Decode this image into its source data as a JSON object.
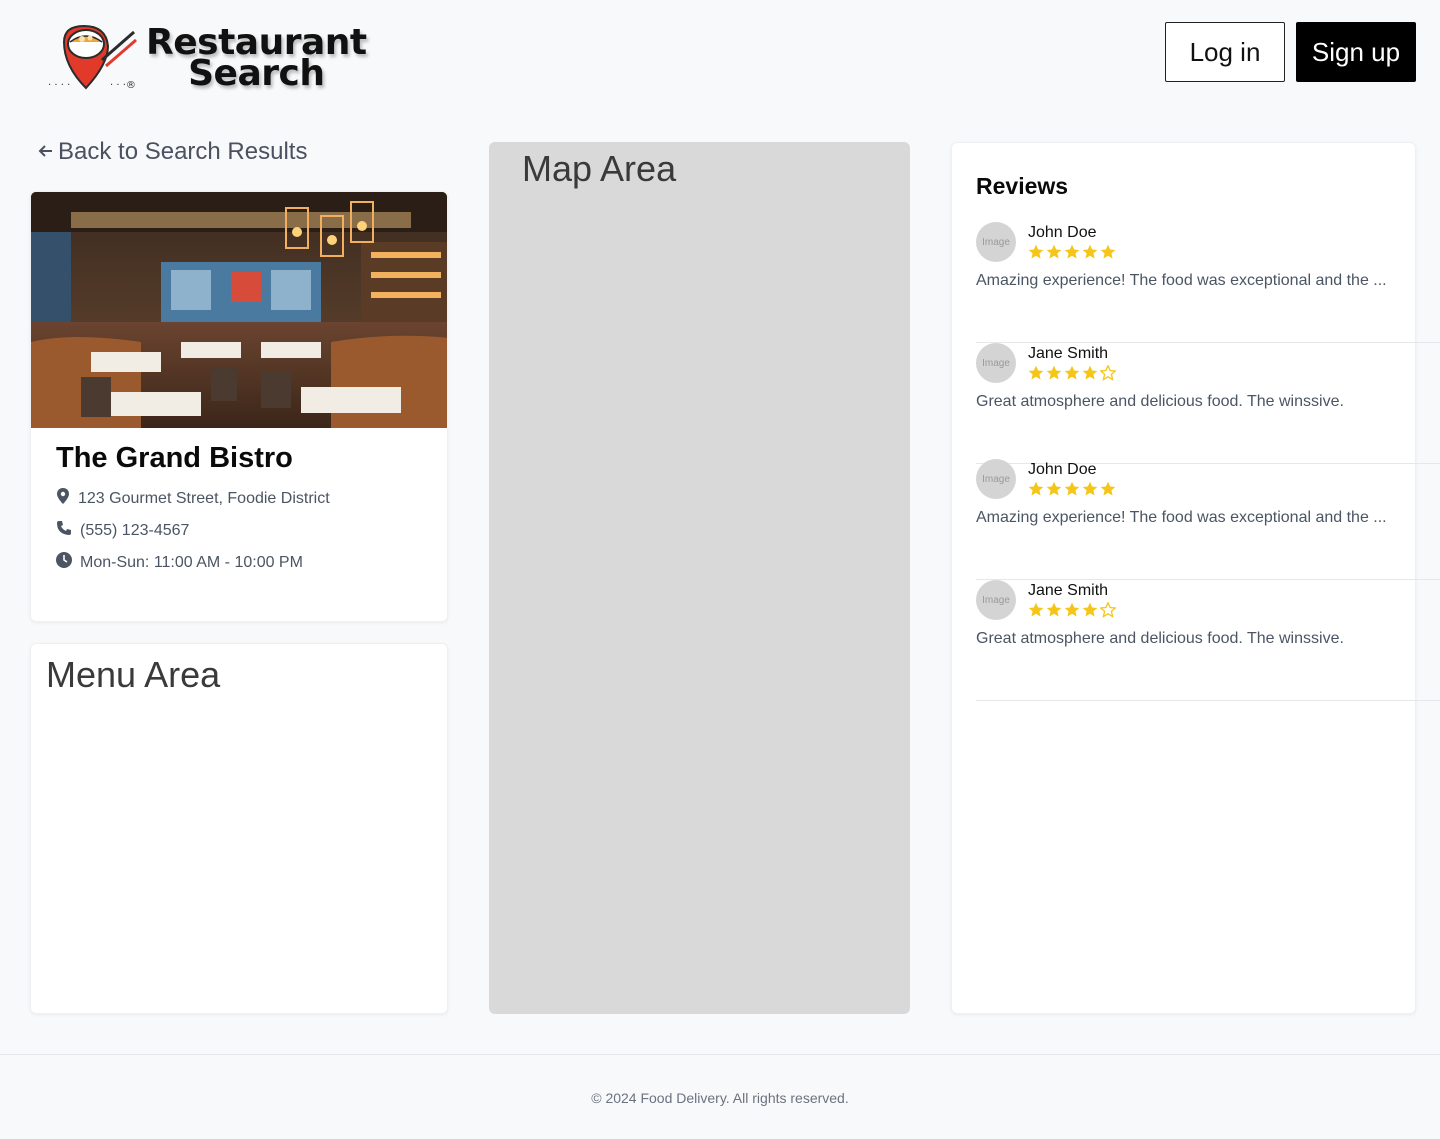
{
  "header": {
    "logo_line1": "Restaurant",
    "logo_line2": "Search",
    "login_label": "Log in",
    "signup_label": "Sign up"
  },
  "back_link": {
    "label": "Back to Search Results",
    "icon": "arrow-left-icon"
  },
  "restaurant": {
    "name": "The Grand Bistro",
    "address": "123 Gourmet Street, Foodie District",
    "phone": "(555) 123-4567",
    "hours": "Mon-Sun: 11:00 AM - 10:00 PM"
  },
  "menu_area": {
    "title": "Menu Area"
  },
  "map_area": {
    "title": "Map Area"
  },
  "reviews": {
    "title": "Reviews",
    "items": [
      {
        "avatar_label": "Image",
        "name": "John Doe",
        "rating": 5,
        "text": "Amazing experience! The food was exceptional and the ..."
      },
      {
        "avatar_label": "Image",
        "name": "Jane Smith",
        "rating": 4,
        "text": "Great atmosphere and delicious food. The winssive."
      },
      {
        "avatar_label": "Image",
        "name": "John Doe",
        "rating": 5,
        "text": "Amazing experience! The food was exceptional and the ..."
      },
      {
        "avatar_label": "Image",
        "name": "Jane Smith",
        "rating": 4,
        "text": "Great atmosphere and delicious food. The winssive."
      }
    ]
  },
  "footer": {
    "text": "© 2024 Food Delivery. All rights reserved."
  },
  "colors": {
    "star": "#f5c518",
    "star_outline": "#f5c518",
    "map_bg": "#d9d9d9",
    "accent_dark": "#000000"
  }
}
